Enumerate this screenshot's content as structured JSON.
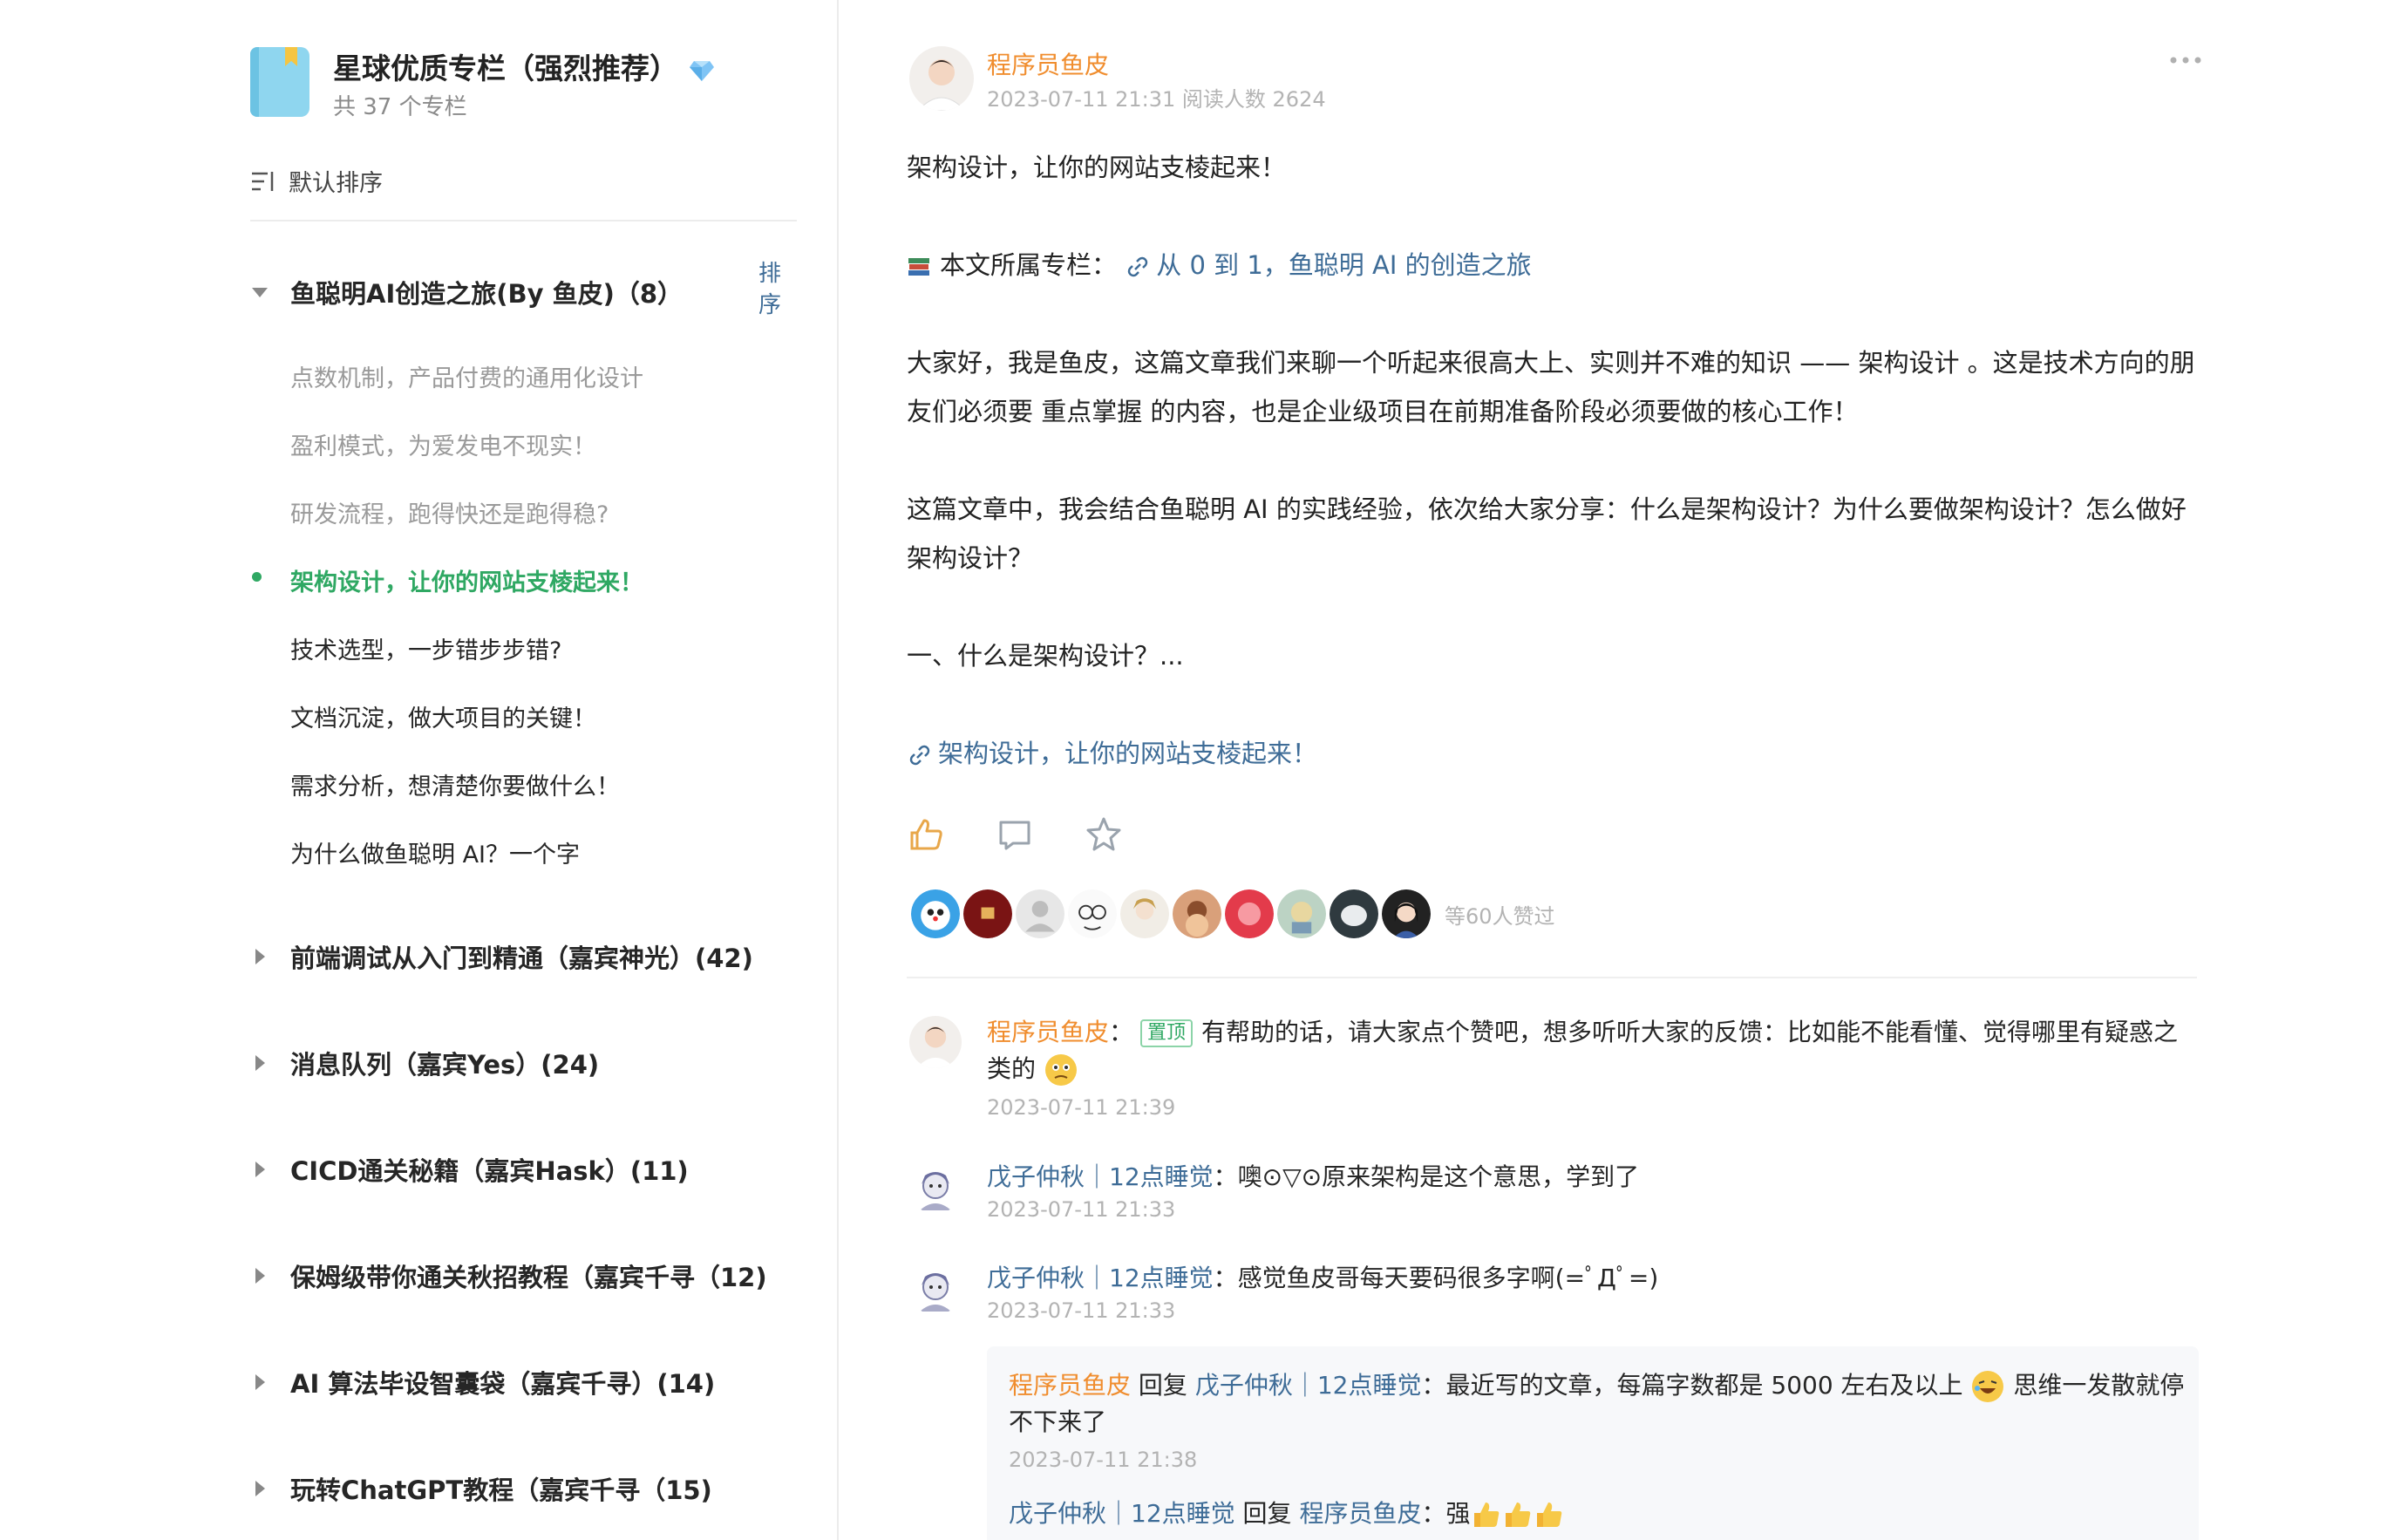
{
  "sidebar": {
    "title": "星球优质专栏（强烈推荐）",
    "count": "共 37 个专栏",
    "sort_label": "默认排序",
    "chapters": [
      {
        "title": "鱼聪明AI创造之旅(By 鱼皮)（8）",
        "expanded": true
      },
      {
        "title": "前端调试从入门到精通（嘉宾神光）(42)",
        "expanded": false
      },
      {
        "title": "消息队列（嘉宾Yes）(24)",
        "expanded": false
      },
      {
        "title": "CICD通关秘籍（嘉宾Hask）(11)",
        "expanded": false
      },
      {
        "title": "保姆级带你通关秋招教程（嘉宾千寻（12)",
        "expanded": false
      },
      {
        "title": "AI 算法毕设智囊袋（嘉宾千寻）(14)",
        "expanded": false
      },
      {
        "title": "玩转ChatGPT教程（嘉宾千寻（15)",
        "expanded": false
      }
    ],
    "chapter_sort_label": "排序",
    "articles": [
      {
        "title": "点数机制，产品付费的通用化设计",
        "state": "read"
      },
      {
        "title": "盈利模式，为爱发电不现实！",
        "state": "read"
      },
      {
        "title": "研发流程，跑得快还是跑得稳?",
        "state": "read"
      },
      {
        "title": "架构设计，让你的网站支棱起来！",
        "state": "active"
      },
      {
        "title": "技术选型，一步错步步错?",
        "state": "unread"
      },
      {
        "title": "文档沉淀，做大项目的关键！",
        "state": "unread"
      },
      {
        "title": "需求分析，想清楚你要做什么！",
        "state": "unread"
      },
      {
        "title": "为什么做鱼聪明 AI？一个字",
        "state": "unread"
      }
    ]
  },
  "post": {
    "author": "程序员鱼皮",
    "meta": "2023-07-11 21:31   阅读人数 2624",
    "title_line": "架构设计，让你的网站支棱起来！",
    "column_prefix": "本文所属专栏：",
    "column_link": "从 0 到 1，鱼聪明 AI 的创造之旅",
    "paragraph1": "大家好，我是鱼皮，这篇文章我们来聊一个听起来很高大上、实则并不难的知识 —— 架构设计 。这是技术方向的朋友们必须要 重点掌握 的内容，也是企业级项目在前期准备阶段必须要做的核心工作！",
    "paragraph2": "这篇文章中，我会结合鱼聪明 AI 的实践经验，依次给大家分享：什么是架构设计？为什么要做架构设计？怎么做好架构设计？",
    "heading1": "一、什么是架构设计？...",
    "article_link": "架构设计，让你的网站支棱起来！",
    "likes_text": "等60人赞过"
  },
  "comments": [
    {
      "name": "程序员鱼皮",
      "pinned_label": "置顶",
      "text": "有帮助的话，请大家点个赞吧，想多听听大家的反馈：比如能不能看懂、觉得哪里有疑惑之类的",
      "time": "2023-07-11 21:39"
    },
    {
      "name": "戊子仲秋｜12点睡觉",
      "text": "噢⊙▽⊙原来架构是这个意思，学到了",
      "time": "2023-07-11 21:33"
    },
    {
      "name": "戊子仲秋｜12点睡觉",
      "text": "感觉鱼皮哥每天要码很多字啊(=ﾟДﾟ=)",
      "time": "2023-07-11 21:33"
    }
  ],
  "replies": [
    {
      "from": "程序员鱼皮",
      "reply_word": "回复",
      "to": "戊子仲秋｜12点睡觉",
      "text_before": "最近写的文章，每篇字数都是 5000 左右及以上",
      "text_after": "思维一发散就停不下来了",
      "time": "2023-07-11 21:38"
    },
    {
      "from": "戊子仲秋｜12点睡觉",
      "reply_word": "回复",
      "to": "程序员鱼皮",
      "text": "强"
    }
  ],
  "colors": {
    "accent_green": "#2fa863",
    "link_blue": "#3e6c97",
    "author_orange": "#f08d2e",
    "muted_gray": "#9a9a9a"
  }
}
